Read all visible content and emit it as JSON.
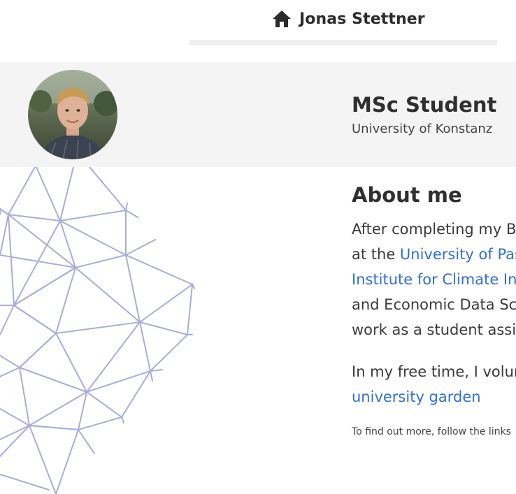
{
  "header": {
    "brand_name": "Jonas Stettner",
    "brand_icon": "home-icon"
  },
  "profile": {
    "role": "MSc Student",
    "organization": "University of Konstanz"
  },
  "about": {
    "title": "About me",
    "line1": "After completing my B",
    "line2_prefix": "at the ",
    "line2_link": "University of Pas",
    "line3_link": "Institute for Climate In",
    "line4": "and Economic Data Sc",
    "line5": "work as a student assis",
    "free_time_prefix": "In my free time, I volun",
    "garden_link": "university garden",
    "more_text": "To find out more, follow the links"
  },
  "colors": {
    "link": "#2f6fd6",
    "band": "#f4f4f4",
    "mesh": "#a9acdc"
  }
}
